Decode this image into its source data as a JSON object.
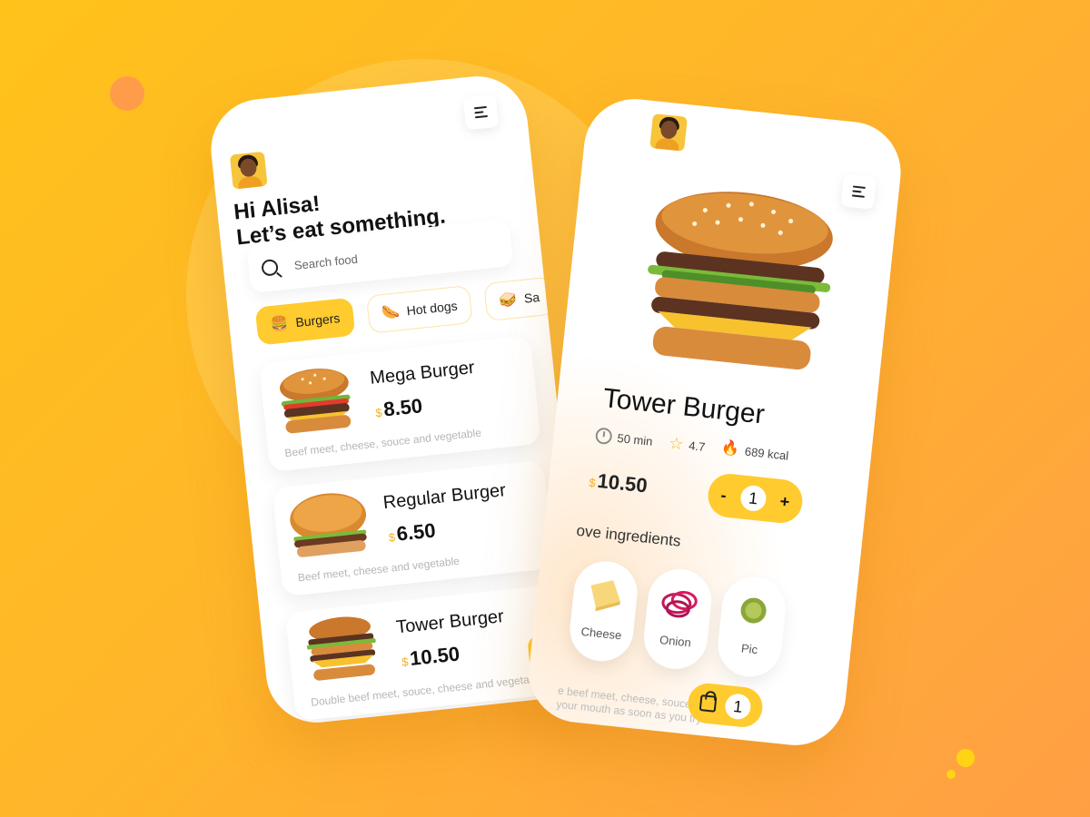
{
  "home": {
    "greeting_line1": "Hi Alisa!",
    "greeting_line2": "Let’s eat something.",
    "search_placeholder": "Search food",
    "categories": [
      {
        "label": "Burgers",
        "icon": "burger-icon",
        "active": true
      },
      {
        "label": "Hot dogs",
        "icon": "hotdog-icon",
        "active": false
      },
      {
        "label": "Sa",
        "icon": "sandwich-icon",
        "active": false
      }
    ],
    "items": [
      {
        "name": "Mega Burger",
        "currency": "$",
        "price": "8.50",
        "desc": "Beef meet, cheese, souce and vegetable"
      },
      {
        "name": "Regular Burger",
        "currency": "$",
        "price": "6.50",
        "desc": "Beef meet, cheese and vegetable"
      },
      {
        "name": "Tower Burger",
        "currency": "$",
        "price": "10.50",
        "desc": "Double beef meet, souce, cheese and vegetable"
      }
    ]
  },
  "detail": {
    "title": "Tower Burger",
    "time": "50 min",
    "rating": "4.7",
    "calories": "689 kcal",
    "currency": "$",
    "price": "10.50",
    "quantity": "1",
    "minus": "-",
    "plus": "+",
    "ingredients_title": "ove ingredients",
    "ingredients": [
      "Cheese",
      "Onion",
      "Pic"
    ],
    "cart_count": "1",
    "description": "e beef meet, cheese, souce, c will melt in your mouth as soon as you try it. We"
  },
  "colors": {
    "accent": "#FFCB2E",
    "background_top": "#FFC21A",
    "background_bottom": "#FF9F45",
    "price_currency": "#F2B120"
  }
}
